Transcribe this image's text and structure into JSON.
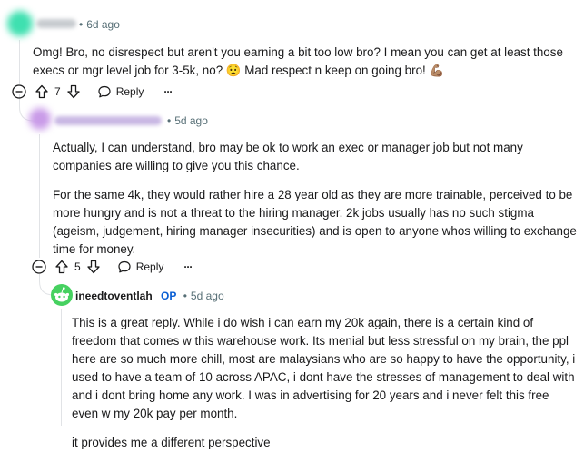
{
  "comments": [
    {
      "author": "",
      "time": "6d ago",
      "body": [
        "Omg! Bro, no disrespect but aren't you earning a bit too low bro? I mean you can get at least those execs or mgr level job for 3-5k, no? 😟 Mad respect n keep on going bro! 💪🏽"
      ],
      "votes": "7",
      "reply_label": "Reply",
      "more_label": "···"
    },
    {
      "author": "",
      "time": "5d ago",
      "body": [
        "Actually, I can understand, bro may be ok to work an exec or manager job but not many companies are willing to give you this chance.",
        "For the same 4k, they would rather hire a 28 year old as they are more trainable, perceived to be more hungry and is not a threat to the hiring manager. 2k jobs usually has no such stigma (ageism, judgement, hiring manager insecurities) and is open to anyone whos willing to exchange time for money."
      ],
      "votes": "5",
      "reply_label": "Reply",
      "more_label": "···"
    },
    {
      "author": "ineedtoventlah",
      "op_badge": "OP",
      "time": "5d ago",
      "body": [
        "This is a great reply. While i do wish i can earn my 20k again, there is a certain kind of freedom that comes w this warehouse work. Its menial but less stressful on my brain, the ppl here are so much more chill, most are malaysians who are so happy to have the opportunity, i used to have a team of 10 across APAC, i dont have the stresses of management to deal with and i dont bring home any work. I was in advertising for 20 years and i never felt this free even w my 20k pay per month.",
        "it provides me a different perspective"
      ]
    }
  ],
  "colors": {
    "avatar1": "#3fe0b0",
    "avatar2": "#c99be8",
    "avatar3": "#46d160",
    "meta": "#576f76",
    "op": "#0a5fd4"
  },
  "icons": [
    "collapse-icon",
    "upvote-icon",
    "downvote-icon",
    "reply-icon",
    "more-icon",
    "snoo-avatar-icon"
  ]
}
